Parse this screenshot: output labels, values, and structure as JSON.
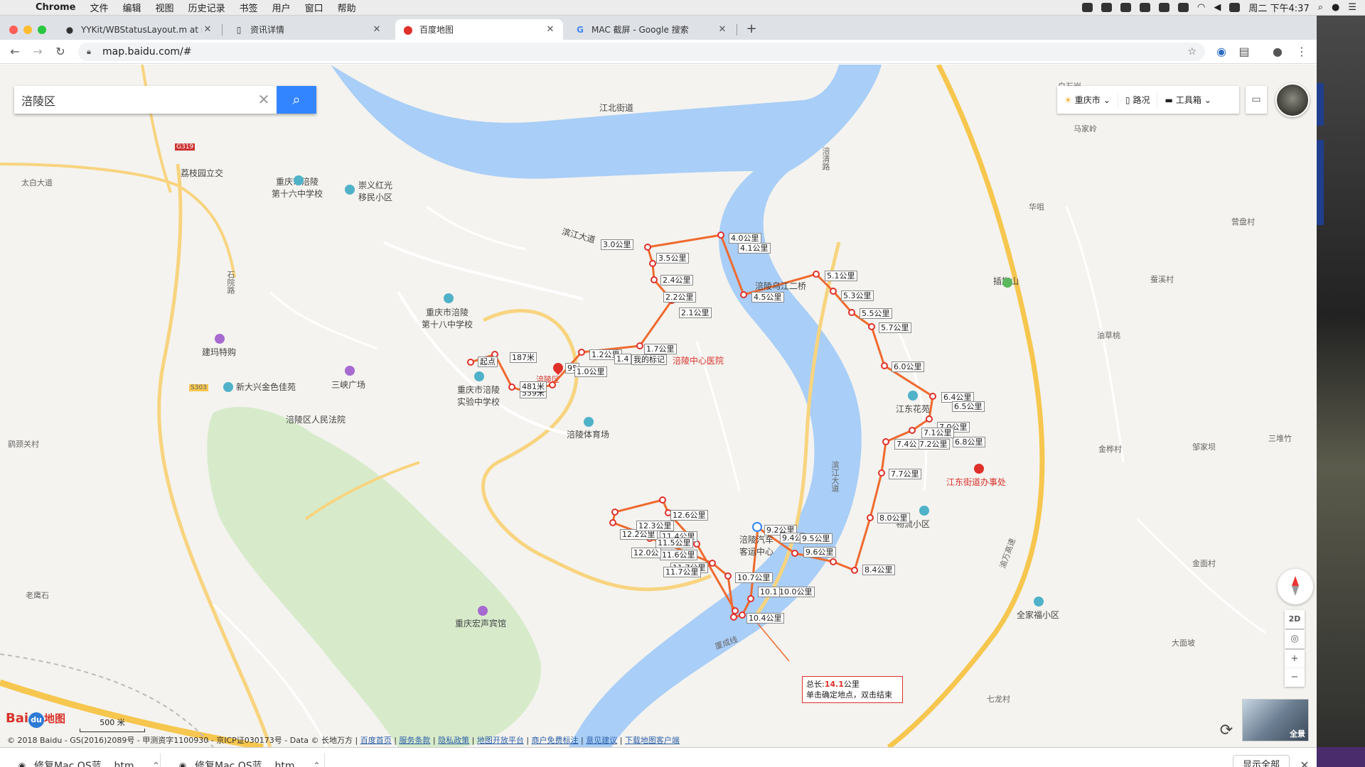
{
  "menubar": {
    "app": "Chrome",
    "items": [
      "文件",
      "编辑",
      "视图",
      "历史记录",
      "书签",
      "用户",
      "窗口",
      "帮助"
    ],
    "clock": "周二 下午4:37"
  },
  "tabs": [
    {
      "title": "YYKit/WBStatusLayout.m at m",
      "icon": "github-icon"
    },
    {
      "title": "资讯详情",
      "icon": "document-icon"
    },
    {
      "title": "百度地图",
      "icon": "map-pin-icon"
    },
    {
      "title": "MAC 截屏 - Google 搜索",
      "icon": "google-icon"
    }
  ],
  "address": "map.baidu.com/#",
  "search": {
    "value": "涪陵区"
  },
  "topctrl": {
    "city": "重庆市",
    "traffic": "路况",
    "toolbox": "工具箱"
  },
  "map_labels": {
    "jiangbei": "江北街道",
    "baishiyan": "白石岩",
    "majialing": "马家岭",
    "huashan": "华咀",
    "yingpancun": "营盘村",
    "chaqishan": "插旗山",
    "canxicun": "蚕溪村",
    "youcaotao": "油草桃",
    "jinhuacun": "金桦村",
    "zoujiaba": "邹家坝",
    "sanduizhu": "三堆竹",
    "jiangongcun": "金面村",
    "quanjiafu": "全家福小区",
    "damianpo": "大面坡",
    "qilongcun": "七龙村",
    "jiangdong_office": "江东街道办事处",
    "jiangdong_garden": "江东花苑",
    "wuliu": "物流小区",
    "lizhiyuan": "荔枝园立交",
    "taibai": "太白大道",
    "school16": "重庆市涪陵\n第十六中学校",
    "chongyi": "崇义红光\n移民小区",
    "g319": "G319",
    "shiyuan": "石院路",
    "school18": "重庆市涪陵\n第十八中学校",
    "jianma": "建玛特购",
    "sanxia": "三峡广场",
    "xindaxing": "新大兴金色佳苑",
    "s303": "S303",
    "hospital_people": "涪陵区人民法院",
    "school_exp": "重庆市涪陵\n实验中学校",
    "stadium": "涪陵体育场",
    "central_hospital": "涪陵中心医院",
    "binjiang": "滨江大道",
    "bridge2": "涪陵乌江二桥",
    "jiangbin": "滨江大道",
    "bus_center": "涪陵汽车\n客运中心",
    "hongsheng": "重庆宏声宾馆",
    "laoying": "老鹰石",
    "zhuoluo": "鹞颈关村",
    "yucheng": "渝万高速",
    "fuqinglu": "涪清路",
    "lianchengxian": "厦成线",
    "start": "起点",
    "mymark": "我的标记",
    "marker": "涪陵区"
  },
  "route_labels": [
    "187米",
    "559米",
    "481米",
    "95",
    "1.0公里",
    "1.2公里",
    "1.4",
    "1.7公里",
    "2.1公里",
    "2.2公里",
    "2.4公里",
    "3.0公里",
    "3.5公里",
    "4.0公里",
    "4.1公里",
    "4.5公里",
    "5.1公里",
    "5.3公里",
    "5.5公里",
    "5.7公里",
    "6.0公里",
    "6.4公里",
    "6.5公里",
    "6.8公里",
    "7.0公里",
    "7.1公里",
    "7.2公里",
    "7.4公",
    "7.7公里",
    "8.0公里",
    "8.4公里",
    "9.2公里",
    "9.4公",
    "9.5公里",
    "9.6公里",
    "10.0公里",
    "10.1",
    "10.4公里",
    "10.7公里",
    "11.4公里",
    "11.5公里",
    "11.6公里",
    "11.7公里",
    "11.7公里",
    "12.0公",
    "12.2公里",
    "12.3公里",
    "12.6公里"
  ],
  "total": {
    "label": "总长:",
    "value": "14.1",
    "unit": "公里",
    "hint": "单击确定地点，双击结束"
  },
  "map_controls": {
    "mode": "2D",
    "zoom_in": "+",
    "zoom_out": "−",
    "pano": "全景"
  },
  "scale": "500 米",
  "logo": {
    "bai": "Bai",
    "du": "du",
    "map": "地图"
  },
  "copyright": {
    "text": "© 2018 Baidu - GS(2016)2089号 - 甲测资字1100930 - 京ICP证030173号 - Data © 长地万方 |",
    "links": [
      "百度首页",
      "服务条款",
      "隐私政策",
      "地图开放平台",
      "商户免费标注",
      "意见建议",
      "下载地图客户端"
    ]
  },
  "downloads": [
    {
      "name": "修复Mac OS蓝....htm"
    },
    {
      "name": "修复Mac OS蓝....htm"
    }
  ],
  "show_all": "显示全部",
  "colors": {
    "route": "#ef6a2f",
    "river": "#9ec6f5",
    "road": "#f8d47f",
    "search": "#3385ff"
  }
}
